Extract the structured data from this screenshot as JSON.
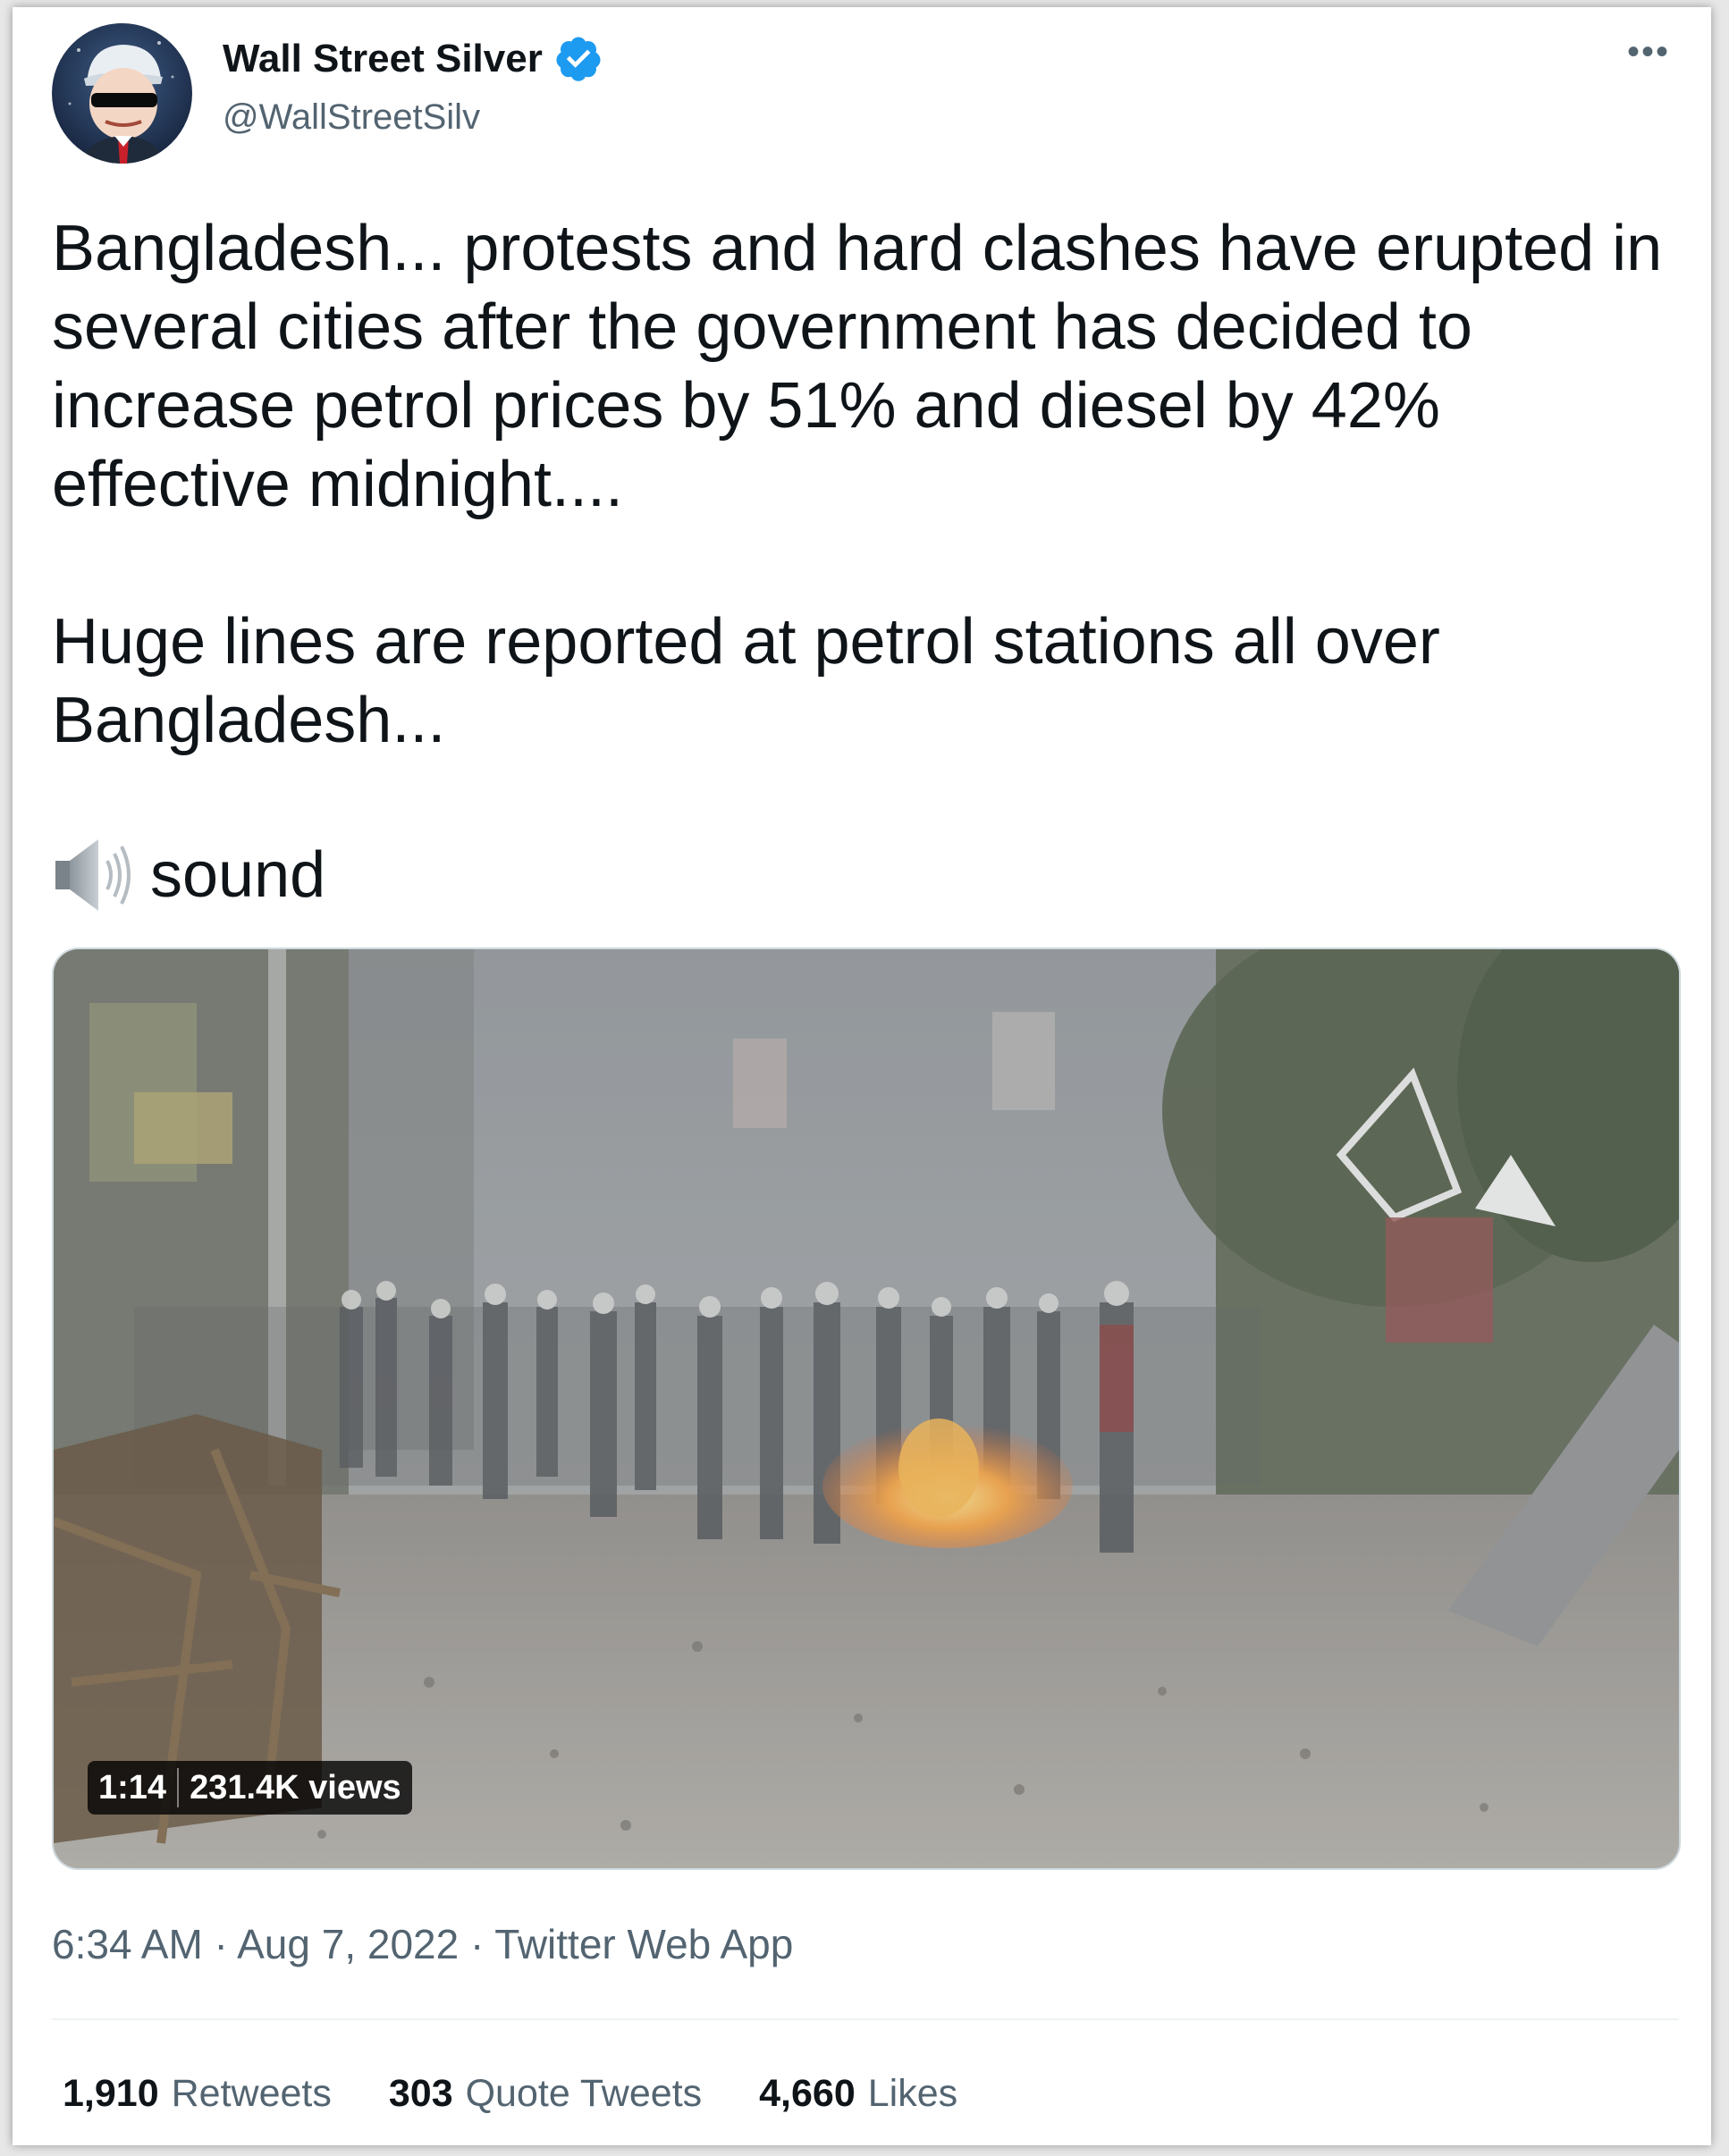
{
  "tweet": {
    "author_name": "Wall Street Silver",
    "handle": "@WallStreetSilv",
    "verified_color": "#1d9bf0",
    "more_icon": "•••",
    "text_para1": "Bangladesh... protests and hard clashes have erupted in several cities after the government has decided to increase petrol prices by 51% and diesel by 42% effective midnight....",
    "text_para2": "Huge lines are reported at petrol stations all over Bangladesh...",
    "sound_label": "sound",
    "video": {
      "duration": "1:14",
      "views": "231.4K views"
    },
    "timestamp": "6:34 AM · Aug 7, 2022 · Twitter Web App",
    "stats": [
      {
        "count": "1,910",
        "label": "Retweets"
      },
      {
        "count": "303",
        "label": "Quote Tweets"
      },
      {
        "count": "4,660",
        "label": "Likes"
      }
    ]
  }
}
